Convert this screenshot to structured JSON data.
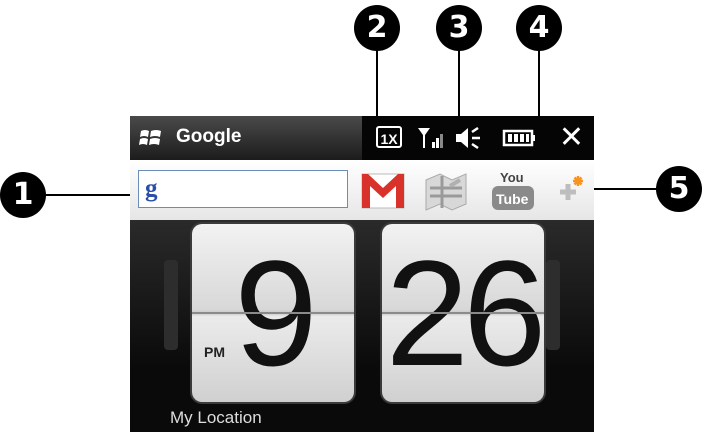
{
  "callouts": [
    "1",
    "2",
    "3",
    "4",
    "5"
  ],
  "titlebar": {
    "app_title": "Google",
    "network_badge": "1X",
    "close_glyph": "✕",
    "icons": [
      "windows-start-icon",
      "signal-strength-icon",
      "volume-icon",
      "battery-icon",
      "close-icon"
    ]
  },
  "toolbar": {
    "search_logo": "g",
    "shortcuts": [
      "gmail-icon",
      "maps-icon",
      "youtube-icon",
      "add-shortcut-icon"
    ]
  },
  "clock": {
    "hour": "9",
    "minute": "26",
    "ampm": "PM"
  },
  "location_label": "My Location",
  "colors": {
    "gmail_red": "#d8322a",
    "youtube_red": "#c81e1e",
    "add_orange": "#f7931e",
    "search_border": "#6b8db8"
  }
}
